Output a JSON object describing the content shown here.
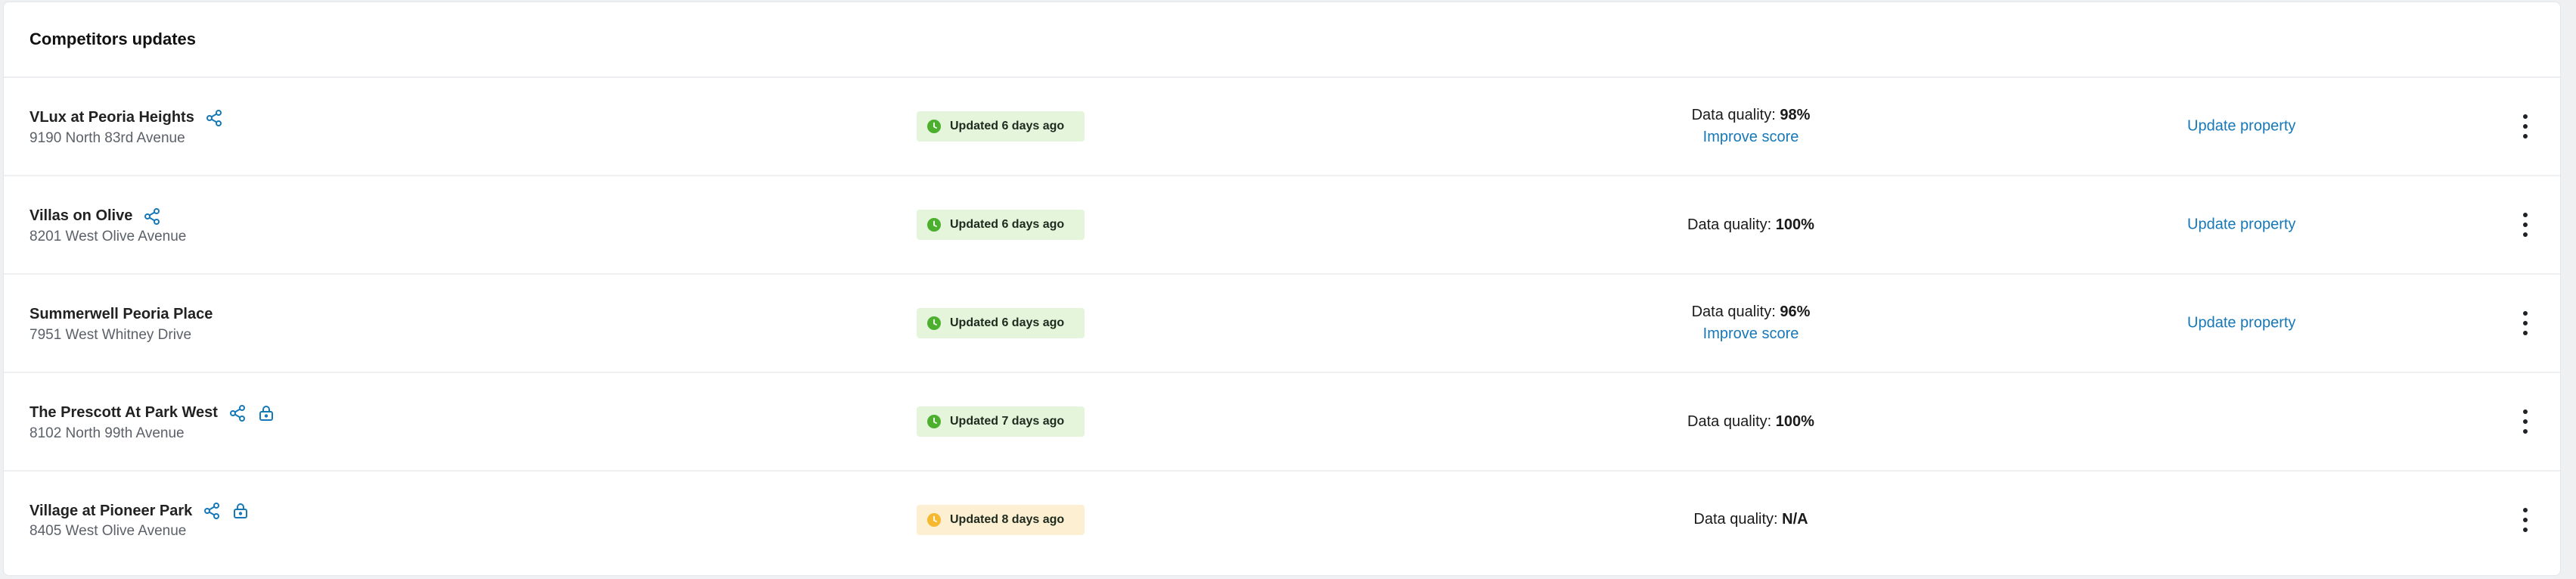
{
  "panel": {
    "title": "Competitors updates"
  },
  "rows": [
    {
      "name": "VLux at Peoria Heights",
      "address": "9190 North 83rd Avenue",
      "share_icon": "share-icon",
      "status": "Updated 6 days ago",
      "status_level": "fresh",
      "quality_label": "Data quality:",
      "quality_value": "98%",
      "improve": "Improve score",
      "update": "Update property"
    },
    {
      "name": "Villas on Olive",
      "address": "8201 West Olive Avenue",
      "share_icon": "share-icon",
      "status": "Updated 6 days ago",
      "status_level": "fresh",
      "quality_label": "Data quality:",
      "quality_value": "100%",
      "update": "Update property"
    },
    {
      "name": "Summerwell Peoria Place",
      "address": "7951 West Whitney Drive",
      "status": "Updated 6 days ago",
      "status_level": "fresh",
      "quality_label": "Data quality:",
      "quality_value": "96%",
      "improve": "Improve score",
      "update": "Update property"
    },
    {
      "name": "The Prescott At Park West",
      "address": "8102 North 99th Avenue",
      "share_icon": "share-icon",
      "lock_icon": "lock-icon",
      "status": "Updated 7 days ago",
      "status_level": "fresh",
      "quality_label": "Data quality:",
      "quality_value": "100%"
    },
    {
      "name": "Village at Pioneer Park",
      "address": "8405 West Olive Avenue",
      "share_icon": "share-icon",
      "lock_icon": "lock-icon",
      "status": "Updated 8 days ago",
      "status_level": "stale",
      "quality_label": "Data quality:",
      "quality_value": "N/A"
    }
  ],
  "colors": {
    "link": "#1778b8",
    "fresh_bg": "#e4f5dc",
    "fresh_dot": "#4caf2e",
    "stale_bg": "#fdf0d2",
    "stale_dot": "#f5b82e"
  }
}
